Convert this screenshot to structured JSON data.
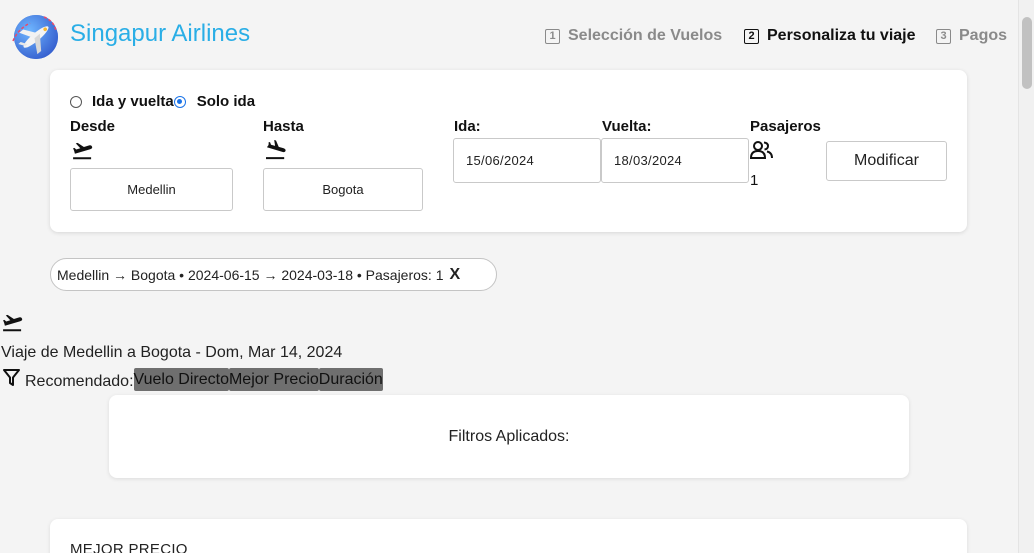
{
  "header": {
    "brand": "Singapur Airlines",
    "steps": [
      {
        "num": "1",
        "label": "Selección de Vuelos",
        "state": "inactive"
      },
      {
        "num": "2",
        "label": "Personaliza tu viaje",
        "state": "active"
      },
      {
        "num": "3",
        "label": "Pagos",
        "state": "inactive"
      }
    ]
  },
  "search": {
    "trip_type": {
      "round": "Ida y vuelta",
      "oneway": "Solo ida",
      "selected": "oneway"
    },
    "from_label": "Desde",
    "to_label": "Hasta",
    "depart_label": "Ida:",
    "return_label": "Vuelta:",
    "pax_label": "Pasajeros",
    "from_value": "Medellin",
    "to_value": "Bogota",
    "depart_value": "15/06/2024",
    "return_value": "18/03/2024",
    "pax_value": "1",
    "modify_button": "Modificar"
  },
  "summary_chip": {
    "text": "Medellin → Bogota • 2024-06-15 → 2024-03-18 • Pasajeros: 1",
    "close": "X"
  },
  "trip": {
    "title": "Viaje de Medellin a Bogota - Dom, Mar 14, 2024",
    "recommended_label": "Recomendado:",
    "filters": [
      "Vuelo Directo",
      "Mejor Precio",
      "Duración"
    ]
  },
  "applied_filters": {
    "label": "Filtros Aplicados:"
  },
  "results": {
    "first_header": "MEJOR PRECIO"
  },
  "colors": {
    "brand": "#2aaee6",
    "tag_bg": "#6f6f6f",
    "radio_checked": "#1a73e8"
  }
}
